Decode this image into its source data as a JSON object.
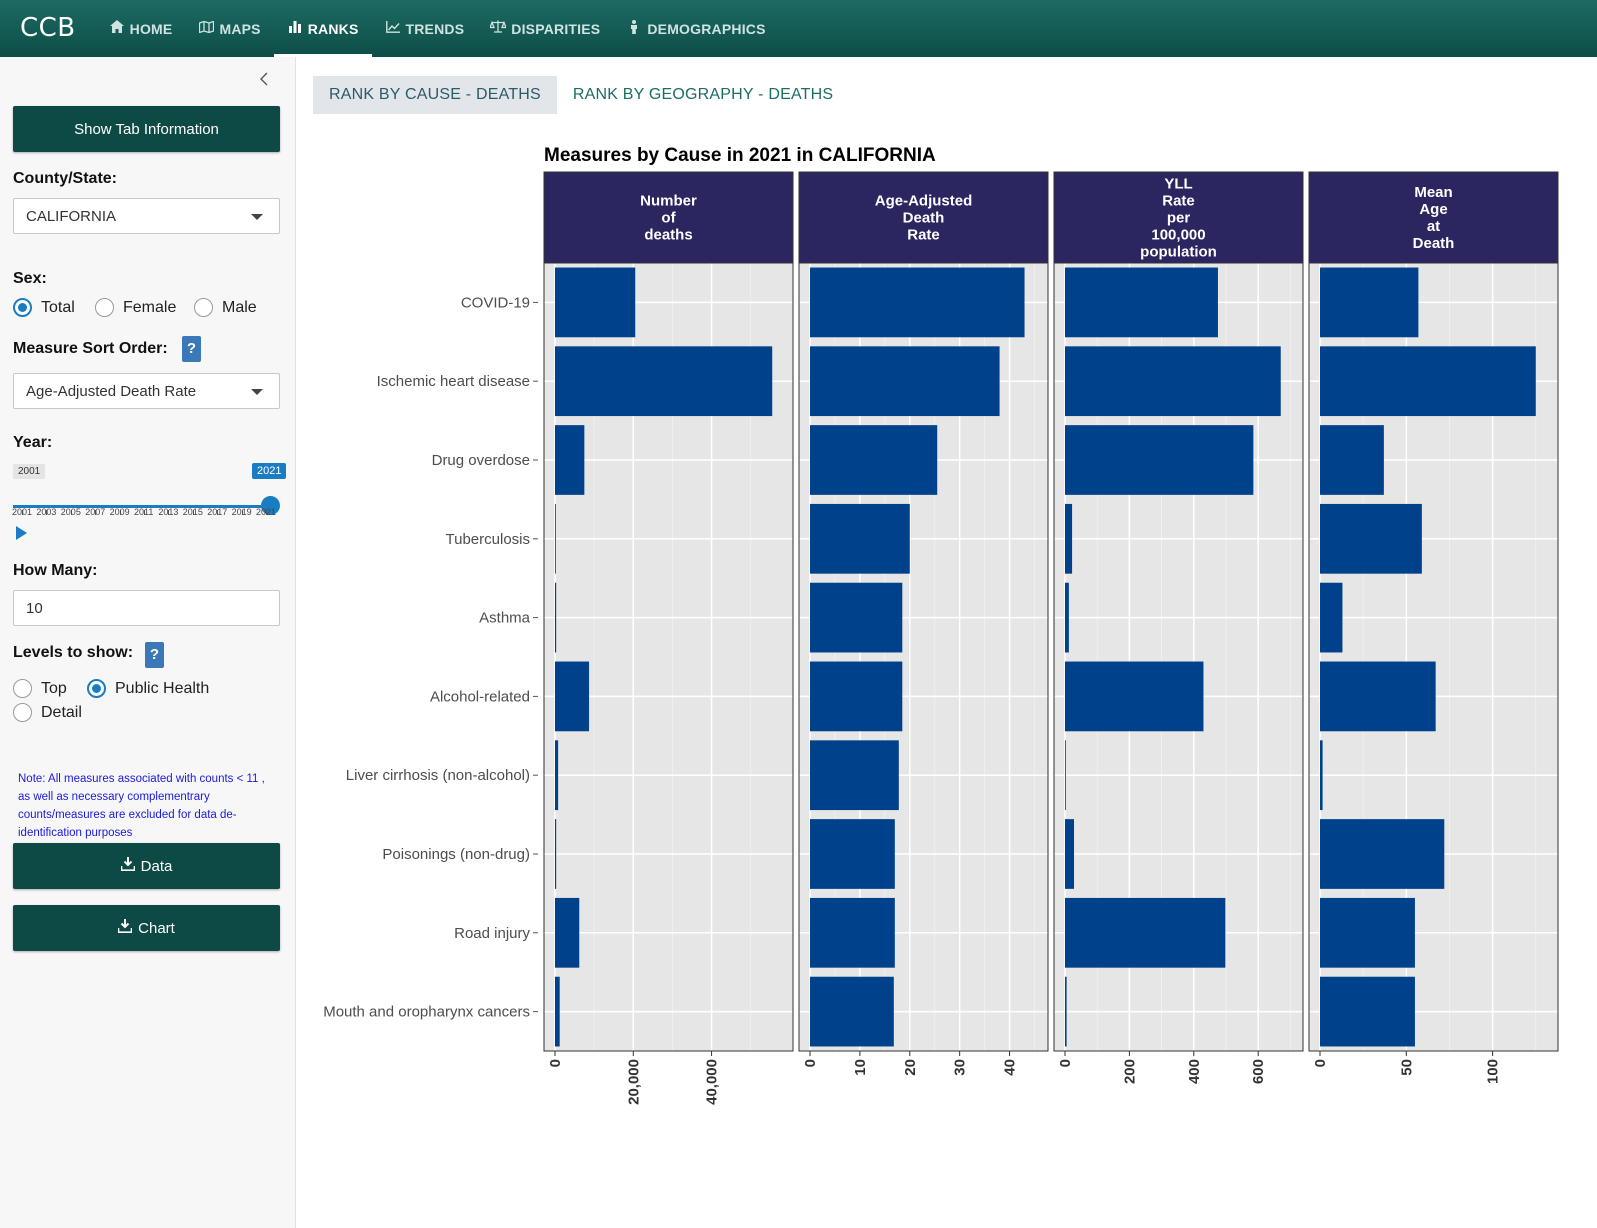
{
  "nav": {
    "brand": "CCB",
    "items": [
      {
        "label": "HOME",
        "icon": "home-icon"
      },
      {
        "label": "MAPS",
        "icon": "map-icon"
      },
      {
        "label": "RANKS",
        "icon": "bar-chart-icon"
      },
      {
        "label": "TRENDS",
        "icon": "line-chart-icon"
      },
      {
        "label": "DISPARITIES",
        "icon": "balance-scale-icon"
      },
      {
        "label": "DEMOGRAPHICS",
        "icon": "person-icon"
      }
    ],
    "active": "RANKS"
  },
  "sidebar": {
    "show_info_label": "Show Tab Information",
    "county_label": "County/State:",
    "county_value": "CALIFORNIA",
    "sex_label": "Sex:",
    "sex_options": [
      "Total",
      "Female",
      "Male"
    ],
    "sex_selected": "Total",
    "sort_label": "Measure Sort Order:",
    "sort_value": "Age-Adjusted Death Rate",
    "help_label": "?",
    "year_label": "Year:",
    "year_min": "2001",
    "year_selected": "2021",
    "year_ticks": [
      "2001",
      "2003",
      "2005",
      "2007",
      "2009",
      "2011",
      "2013",
      "2015",
      "2017",
      "2019",
      "2021"
    ],
    "how_many_label": "How Many:",
    "how_many_value": "10",
    "levels_label": "Levels to show:",
    "levels_options": [
      "Top",
      "Public Health",
      "Detail"
    ],
    "levels_selected": "Public Health",
    "note": "Note: All measures associated with counts < 11 , as well as necessary complementrary counts/measures are excluded for data de-identification purposes",
    "data_button": "Data",
    "chart_button": "Chart"
  },
  "tabs": [
    "RANK BY CAUSE - DEATHS",
    "RANK BY GEOGRAPHY - DEATHS"
  ],
  "active_tab": "RANK BY CAUSE - DEATHS",
  "chart_data": {
    "type": "bar",
    "orientation": "horizontal",
    "title": "Measures by Cause in 2021 in CALIFORNIA",
    "bar_color": "#00418c",
    "panel_header_color": "#2b2560",
    "categories": [
      "COVID-19",
      "Ischemic heart disease",
      "Drug overdose",
      "Tuberculosis",
      "Asthma",
      "Alcohol-related",
      "Liver cirrhosis (non-alcohol)",
      "Poisonings (non-drug)",
      "Road injury",
      "Mouth and oropharynx cancers"
    ],
    "panels": [
      {
        "name": "Number\nof\ndeaths",
        "values": [
          20500,
          55500,
          7500,
          150,
          300,
          8700,
          800,
          300,
          6200,
          1200
        ],
        "xlim": [
          0,
          58000
        ],
        "ticks": [
          0,
          20000,
          40000
        ],
        "tick_labels": [
          "0",
          "20,000",
          "40,000"
        ]
      },
      {
        "name": "Age-Adjusted\nDeath\nRate",
        "values": [
          43,
          38,
          25.5,
          20,
          18.5,
          18.5,
          17.8,
          17,
          17,
          16.8
        ],
        "xlim": [
          0,
          45.5
        ],
        "ticks": [
          0,
          10,
          20,
          30,
          40
        ],
        "tick_labels": [
          "0",
          "10",
          "20",
          "30",
          "40"
        ]
      },
      {
        "name": "YLL\nRate\nper\n100,000\npopulation",
        "values": [
          475,
          670,
          585,
          22,
          12,
          430,
          2,
          28,
          498,
          5
        ],
        "xlim": [
          0,
          705
        ],
        "ticks": [
          0,
          200,
          400,
          600
        ],
        "tick_labels": [
          "0",
          "200",
          "400",
          "600"
        ]
      },
      {
        "name": "Mean\nAge\nat\nDeath",
        "values": [
          57,
          125,
          37,
          59,
          13,
          67,
          1.5,
          72,
          55,
          55
        ],
        "xlim": [
          0,
          131.5
        ],
        "ticks": [
          0,
          50,
          100
        ],
        "tick_labels": [
          "0",
          "50",
          "100"
        ]
      }
    ]
  }
}
